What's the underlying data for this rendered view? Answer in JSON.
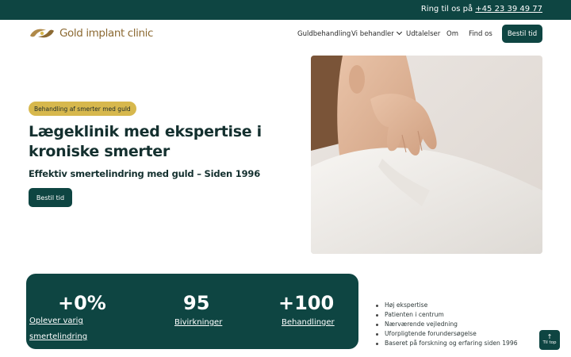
{
  "topbar": {
    "call_prefix": "Ring til os på",
    "phone": "+45 23 39 49 77"
  },
  "brand": {
    "name": "Gold implant clinic",
    "logo_icon": "gold-hands-logo",
    "color": "#8c6a33"
  },
  "nav": {
    "items": [
      {
        "label": "Guldbehandling"
      },
      {
        "label": "Vi behandler",
        "icon": "chevron-down-icon"
      },
      {
        "label": "Udtalelser"
      },
      {
        "label": "Om"
      },
      {
        "label": "Find os"
      }
    ],
    "cta": "Bestil tid"
  },
  "hero": {
    "badge": "Behandling af smerter med guld",
    "title": "Lægeklinik med ekspertise i kroniske smerter",
    "subtitle": "Effektiv smertelindring med guld – Siden 1996",
    "cta": "Bestil tid",
    "image": "woman-holding-neck-photo"
  },
  "stats": [
    {
      "value": "+0%",
      "label_line1": "Oplever varig",
      "label_line2": "smertelindring"
    },
    {
      "value": "95",
      "label": "Bivirkninger"
    },
    {
      "value": "+100",
      "label": "Behandlinger"
    }
  ],
  "features": [
    "Høj ekspertise",
    "Patienten i centrum",
    "Nærværende vejledning",
    "Uforpligtende forundersøgelse",
    "Baseret på forskning og erfaring siden 1996"
  ],
  "to_top": {
    "label": "Til top",
    "icon": "arrow-up-icon"
  },
  "colors": {
    "primary": "#0e4542",
    "gold": "#d7b84d",
    "logo": "#8c6a33"
  }
}
